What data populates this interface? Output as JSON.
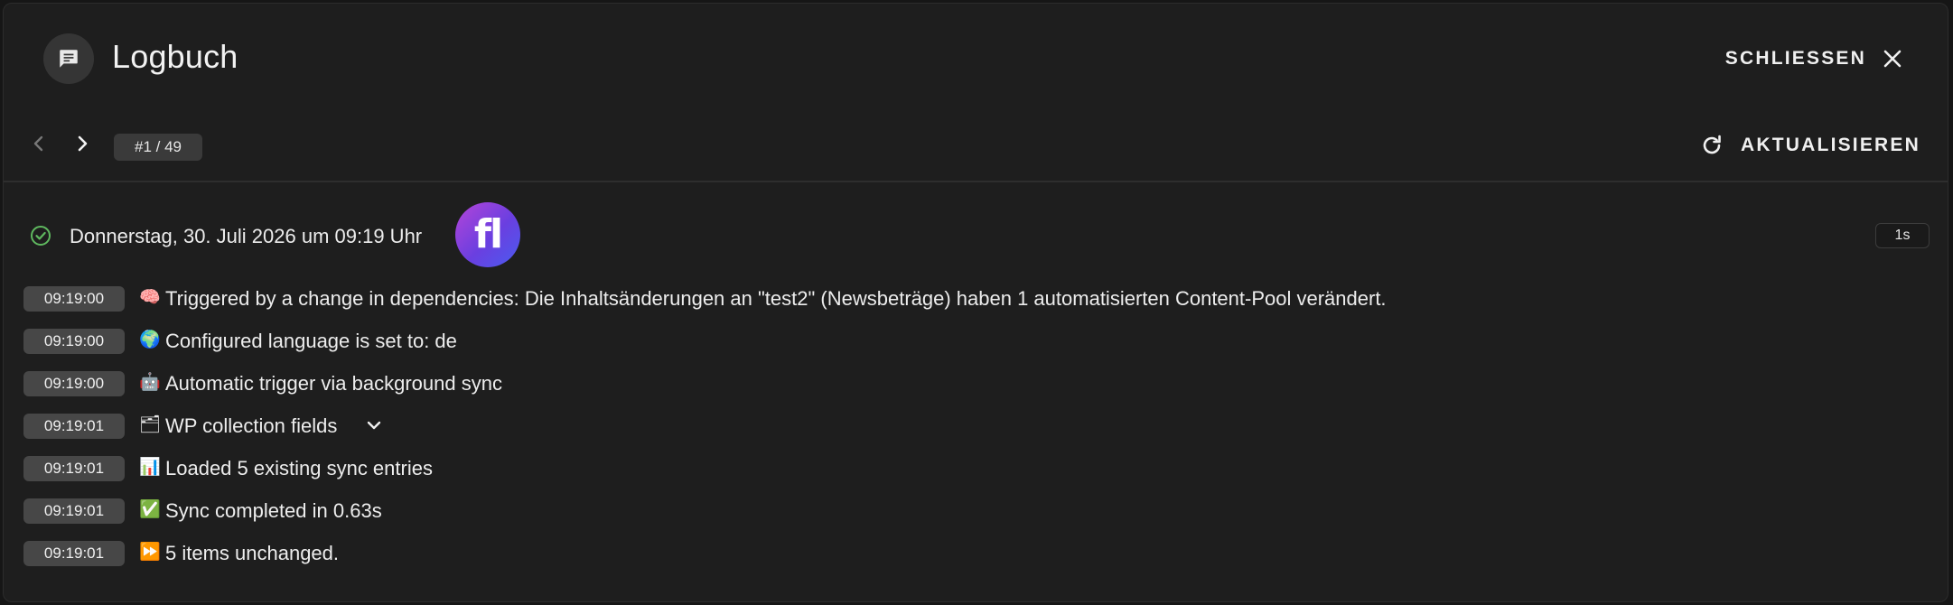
{
  "header": {
    "title": "Logbuch",
    "close_label": "SCHLIESSEN",
    "icon": "chat-list-icon"
  },
  "toolbar": {
    "page_indicator": "#1 / 49",
    "refresh_label": "AKTUALISIEREN"
  },
  "run": {
    "status": "success",
    "date": "Donnerstag, 30. Juli 2026 um 09:19 Uhr",
    "duration": "1s",
    "status_color": "#5fb85f",
    "logo_letters": "fl"
  },
  "log": [
    {
      "time": "09:19:00",
      "icon": "brain",
      "emoji": "🧠",
      "text": "Triggered by a change in dependencies: Die Inhaltsänderungen an \"test2\" (Newsbeträge) haben 1 automatisierten Content-Pool verändert."
    },
    {
      "time": "09:19:00",
      "icon": "globe",
      "emoji": "🌍",
      "text": "Configured language is set to: de"
    },
    {
      "time": "09:19:00",
      "icon": "robot",
      "emoji": "🤖",
      "text": "Automatic trigger via background sync"
    },
    {
      "time": "09:19:01",
      "icon": "folder",
      "emoji": "🗂",
      "text": "WP collection fields",
      "expandable": true
    },
    {
      "time": "09:19:01",
      "icon": "bar-chart",
      "emoji": "📊",
      "text": "Loaded 5 existing sync entries"
    },
    {
      "time": "09:19:01",
      "icon": "check-mark",
      "emoji": "✅",
      "text": "Sync completed in 0.63s"
    },
    {
      "time": "09:19:01",
      "icon": "fast-forward",
      "emoji": "⏩",
      "text": "5 items unchanged."
    }
  ]
}
